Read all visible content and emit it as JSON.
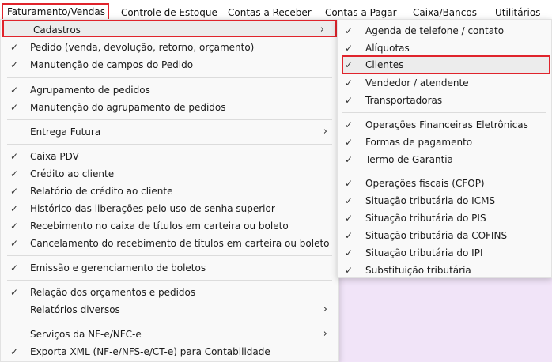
{
  "menubar": {
    "items": [
      {
        "label": "Faturamento/Vendas",
        "active": true
      },
      {
        "label": "Controle de Estoque"
      },
      {
        "label": "Contas a Receber"
      },
      {
        "label": "Contas a Pagar"
      },
      {
        "label": "Caixa/Bancos"
      },
      {
        "label": "Utilitários"
      }
    ]
  },
  "primary_menu": {
    "items": [
      {
        "label": "Cadastros",
        "checked": false,
        "submenu": true,
        "highlighted": true
      },
      {
        "label": "Pedido (venda, devolução, retorno, orçamento)",
        "checked": true
      },
      {
        "label": "Manutenção de campos do Pedido",
        "checked": true
      },
      {
        "label": "Agrupamento de pedidos",
        "checked": true
      },
      {
        "label": "Manutenção do agrupamento de pedidos",
        "checked": true
      },
      {
        "label": "Entrega Futura",
        "checked": false,
        "submenu": true
      },
      {
        "label": "Caixa PDV",
        "checked": true
      },
      {
        "label": "Crédito ao cliente",
        "checked": true
      },
      {
        "label": "Relatório de crédito ao cliente",
        "checked": true
      },
      {
        "label": "Histórico das liberações pelo uso de senha superior",
        "checked": true
      },
      {
        "label": "Recebimento no caixa de títulos em carteira ou boleto",
        "checked": true
      },
      {
        "label": "Cancelamento do recebimento de títulos em carteira ou boleto",
        "checked": true
      },
      {
        "label": "Emissão e gerenciamento de boletos",
        "checked": true
      },
      {
        "label": "Relação dos orçamentos e pedidos",
        "checked": true
      },
      {
        "label": "Relatórios diversos",
        "checked": false,
        "submenu": true
      },
      {
        "label": "Serviços da NF-e/NFC-e",
        "checked": false,
        "submenu": true
      },
      {
        "label": "Exporta XML (NF-e/NFS-e/CT-e) para Contabilidade",
        "checked": true
      }
    ]
  },
  "sub_menu": {
    "items": [
      {
        "label": "Agenda de telefone / contato",
        "checked": true
      },
      {
        "label": "Alíquotas",
        "checked": true
      },
      {
        "label": "Clientes",
        "checked": true,
        "highlighted": true
      },
      {
        "label": "Vendedor / atendente",
        "checked": true
      },
      {
        "label": "Transportadoras",
        "checked": true
      },
      {
        "label": "Operações Financeiras Eletrônicas",
        "checked": true
      },
      {
        "label": "Formas de pagamento",
        "checked": true
      },
      {
        "label": "Termo de Garantia",
        "checked": true
      },
      {
        "label": "Operações fiscais (CFOP)",
        "checked": true
      },
      {
        "label": "Situação tributária do ICMS",
        "checked": true
      },
      {
        "label": "Situação tributária do PIS",
        "checked": true
      },
      {
        "label": "Situação tributária da COFINS",
        "checked": true
      },
      {
        "label": "Situação tributária do IPI",
        "checked": true
      },
      {
        "label": "Substituição tributária",
        "checked": true
      }
    ]
  },
  "icons": {
    "check": "✓",
    "submenu_arrow": "›"
  },
  "colors": {
    "highlight_border": "#e0242c",
    "menu_background": "#f9f9f9",
    "app_background": "#f1e4f8"
  }
}
